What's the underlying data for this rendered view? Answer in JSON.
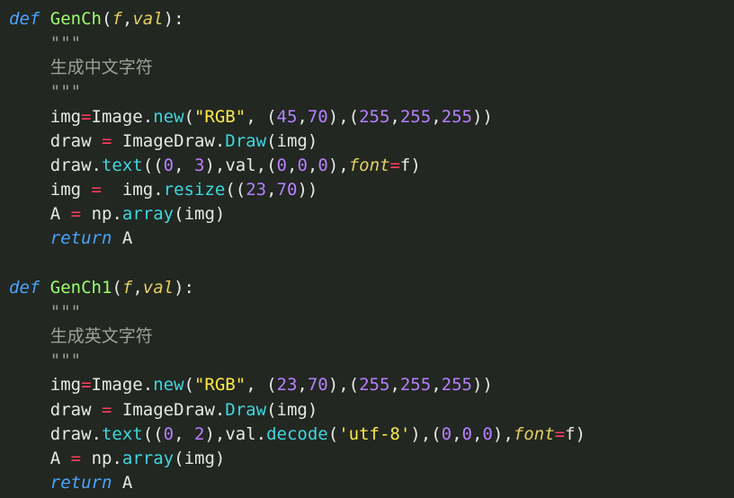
{
  "code": {
    "language": "python",
    "functions": [
      {
        "name": "GenCh",
        "params": [
          "f",
          "val"
        ],
        "docstring": "生成中文字符",
        "body_lines": [
          {
            "text": "img=Image.new(\"RGB\", (45,70),(255,255,255))",
            "assigns": "img",
            "calls": [
              "Image.new"
            ],
            "string_literals": [
              "RGB"
            ],
            "number_literals": [
              45,
              70,
              255,
              255,
              255
            ]
          },
          {
            "text": "draw = ImageDraw.Draw(img)",
            "assigns": "draw",
            "calls": [
              "ImageDraw.Draw"
            ]
          },
          {
            "text": "draw.text((0, 3),val,(0,0,0),font=f)",
            "calls": [
              "draw.text"
            ],
            "number_literals": [
              0,
              3,
              0,
              0,
              0
            ],
            "kwargs": {
              "font": "f"
            }
          },
          {
            "text": "img =  img.resize((23,70))",
            "assigns": "img",
            "calls": [
              "img.resize"
            ],
            "number_literals": [
              23,
              70
            ]
          },
          {
            "text": "A = np.array(img)",
            "assigns": "A",
            "calls": [
              "np.array"
            ]
          },
          {
            "text": "return A",
            "returns": "A"
          }
        ]
      },
      {
        "name": "GenCh1",
        "params": [
          "f",
          "val"
        ],
        "docstring": "生成英文字符",
        "body_lines": [
          {
            "text": "img=Image.new(\"RGB\", (23,70),(255,255,255))",
            "assigns": "img",
            "calls": [
              "Image.new"
            ],
            "string_literals": [
              "RGB"
            ],
            "number_literals": [
              23,
              70,
              255,
              255,
              255
            ]
          },
          {
            "text": "draw = ImageDraw.Draw(img)",
            "assigns": "draw",
            "calls": [
              "ImageDraw.Draw"
            ]
          },
          {
            "text": "draw.text((0, 2),val.decode('utf-8'),(0,0,0),font=f)",
            "calls": [
              "draw.text",
              "val.decode"
            ],
            "string_literals": [
              "utf-8"
            ],
            "number_literals": [
              0,
              2,
              0,
              0,
              0
            ],
            "kwargs": {
              "font": "f"
            }
          },
          {
            "text": "A = np.array(img)",
            "assigns": "A",
            "calls": [
              "np.array"
            ]
          },
          {
            "text": "return A",
            "returns": "A"
          }
        ]
      }
    ]
  },
  "tokens": {
    "def": "def",
    "return": "return",
    "triple_quote": "\"\"\""
  },
  "colors": {
    "background": "#222721",
    "keyword": "#4aa3ff",
    "func_def": "#9cff6e",
    "param": "#e4cf63",
    "operator": "#ff3d5f",
    "number": "#b680ff",
    "string": "#ffe94a",
    "doc": "#9f9f97",
    "call": "#3fd6e0",
    "ident": "#e8e8e8"
  }
}
